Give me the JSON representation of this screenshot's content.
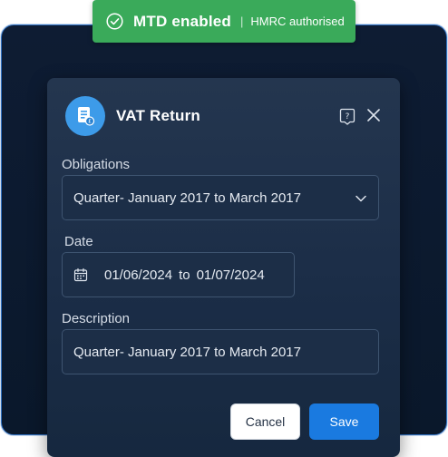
{
  "badge": {
    "title": "MTD enabled",
    "separator": "|",
    "subtitle": "HMRC authorised",
    "icon": "check-circle-icon",
    "color": "#3aaa5a"
  },
  "dialog": {
    "title": "VAT Return",
    "icon": "document-icon",
    "help_icon": "help-icon",
    "close_icon": "close-icon"
  },
  "obligations": {
    "label": "Obligations",
    "value": "Quarter- January 2017 to March 2017",
    "icon": "chevron-down-icon"
  },
  "date": {
    "label": "Date",
    "from": "01/06/2024",
    "connector": "to",
    "to": "01/07/2024",
    "icon": "calendar-icon"
  },
  "description": {
    "label": "Description",
    "value": "Quarter- January 2017 to March 2017"
  },
  "actions": {
    "cancel_label": "Cancel",
    "save_label": "Save",
    "save_color": "#1a7ae0"
  }
}
